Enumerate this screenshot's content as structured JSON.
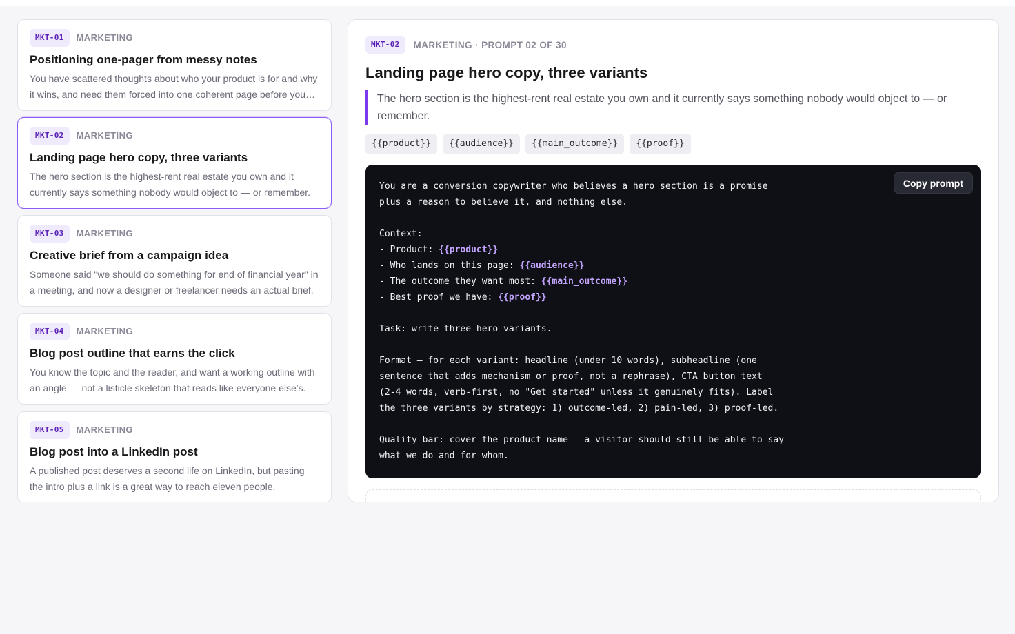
{
  "prompts": [
    {
      "id": "MKT-01",
      "category": "MARKETING",
      "title": "Positioning one-pager from messy notes",
      "desc": "You have scattered thoughts about who your product is for and why it wins, and need them forced into one coherent page before you write anything else."
    },
    {
      "id": "MKT-02",
      "category": "MARKETING",
      "title": "Landing page hero copy, three variants",
      "desc": "The hero section is the highest-rent real estate you own and it currently says something nobody would object to — or remember."
    },
    {
      "id": "MKT-03",
      "category": "MARKETING",
      "title": "Creative brief from a campaign idea",
      "desc": "Someone said \"we should do something for end of financial year\" in a meeting, and now a designer or freelancer needs an actual brief."
    },
    {
      "id": "MKT-04",
      "category": "MARKETING",
      "title": "Blog post outline that earns the click",
      "desc": "You know the topic and the reader, and want a working outline with an angle — not a listicle skeleton that reads like everyone else's."
    },
    {
      "id": "MKT-05",
      "category": "MARKETING",
      "title": "Blog post into a LinkedIn post",
      "desc": "A published post deserves a second life on LinkedIn, but pasting the intro plus a link is a great way to reach eleven people."
    }
  ],
  "detail": {
    "id": "MKT-02",
    "meta": "MARKETING · PROMPT 02 OF 30",
    "title": "Landing page hero copy, three variants",
    "quote": "The hero section is the highest-rent real estate you own and it currently says something nobody would object to — or remember.",
    "variables": [
      "{{product}}",
      "{{audience}}",
      "{{main_outcome}}",
      "{{proof}}"
    ],
    "copy_label": "Copy prompt",
    "code_lines": [
      "You are a conversion copywriter who believes a hero section is a promise",
      "plus a reason to believe it, and nothing else.",
      "",
      "Context:",
      "- Product: {{product}}",
      "- Who lands on this page: {{audience}}",
      "- The outcome they want most: {{main_outcome}}",
      "- Best proof we have: {{proof}}",
      "",
      "Task: write three hero variants.",
      "",
      "Format — for each variant: headline (under 10 words), subheadline (one",
      "sentence that adds mechanism or proof, not a rephrase), CTA button text",
      "(2-4 words, verb-first, no \"Get started\" unless it genuinely fits). Label",
      "the three variants by strategy: 1) outcome-led, 2) pain-led, 3) proof-led.",
      "",
      "Quality bar: cover the product name — a visitor should still be able to say",
      "what we do and for whom."
    ]
  },
  "colors": {
    "accent": "#7c3aed",
    "badge_bg": "#efeafc",
    "code_bg": "#0e1016",
    "code_var": "#c4a5ff"
  }
}
